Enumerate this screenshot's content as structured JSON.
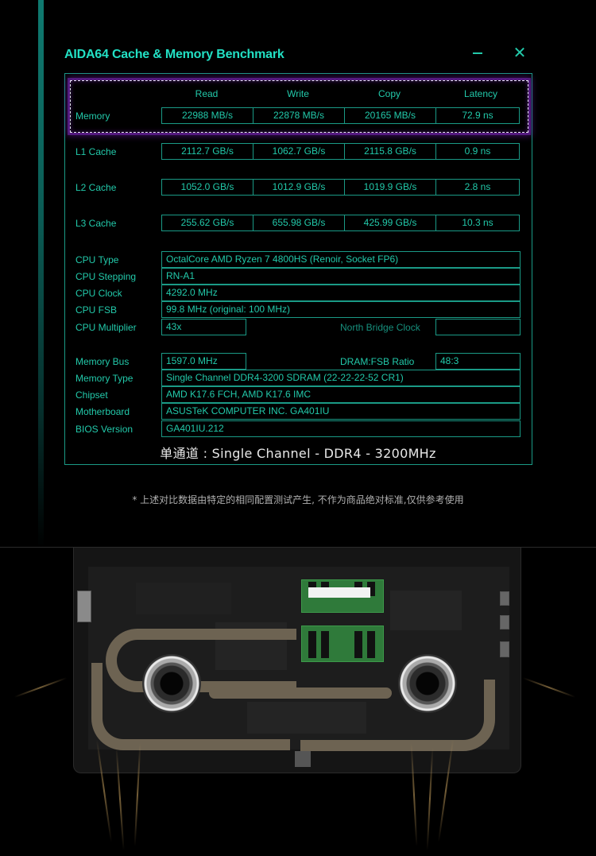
{
  "window": {
    "title": "AIDA64 Cache & Memory Benchmark",
    "minimize_icon": "minimize-icon",
    "close_icon": "close-icon",
    "close_glyph": "✕"
  },
  "benchmark": {
    "columns": [
      "Read",
      "Write",
      "Copy",
      "Latency"
    ],
    "rows": [
      {
        "label": "Memory",
        "read": "22988 MB/s",
        "write": "22878 MB/s",
        "copy": "20165 MB/s",
        "latency": "72.9 ns",
        "highlighted": true
      },
      {
        "label": "L1 Cache",
        "read": "2112.7 GB/s",
        "write": "1062.7 GB/s",
        "copy": "2115.8 GB/s",
        "latency": "0.9 ns"
      },
      {
        "label": "L2 Cache",
        "read": "1052.0 GB/s",
        "write": "1012.9 GB/s",
        "copy": "1019.9 GB/s",
        "latency": "2.8 ns"
      },
      {
        "label": "L3 Cache",
        "read": "255.62 GB/s",
        "write": "655.98 GB/s",
        "copy": "425.99 GB/s",
        "latency": "10.3 ns"
      }
    ]
  },
  "cpu_info": {
    "cpu_type": {
      "label": "CPU Type",
      "value": "OctalCore AMD Ryzen 7 4800HS  (Renoir, Socket FP6)"
    },
    "cpu_stepping": {
      "label": "CPU Stepping",
      "value": "RN-A1"
    },
    "cpu_clock": {
      "label": "CPU Clock",
      "value": "4292.0 MHz"
    },
    "cpu_fsb": {
      "label": "CPU FSB",
      "value": "99.8 MHz  (original: 100 MHz)"
    },
    "cpu_multiplier": {
      "label": "CPU Multiplier",
      "value": "43x"
    },
    "north_bridge_clock": {
      "label": "North Bridge Clock",
      "value": ""
    }
  },
  "memory_info": {
    "memory_bus": {
      "label": "Memory Bus",
      "value": "1597.0 MHz"
    },
    "dram_fsb_ratio": {
      "label": "DRAM:FSB Ratio",
      "value": "48:3"
    },
    "memory_type": {
      "label": "Memory Type",
      "value": "Single Channel DDR4-3200 SDRAM  (22-22-22-52 CR1)"
    },
    "chipset": {
      "label": "Chipset",
      "value": "AMD K17.6 FCH, AMD K17.6 IMC"
    },
    "motherboard": {
      "label": "Motherboard",
      "value": "ASUSTeK COMPUTER INC. GA401IU"
    },
    "bios_version": {
      "label": "BIOS Version",
      "value": "GA401IU.212"
    }
  },
  "summary": "单通道 : Single Channel - DDR4 - 3200MHz",
  "disclaimer": "* 上述对比数据由特定的相同配置测试产生, 不作为商品绝对标准,仅供参考使用",
  "colors": {
    "accent": "#22e0c4",
    "border": "#1a9a86",
    "highlight_glow": "#7828b4",
    "background": "#000000"
  }
}
